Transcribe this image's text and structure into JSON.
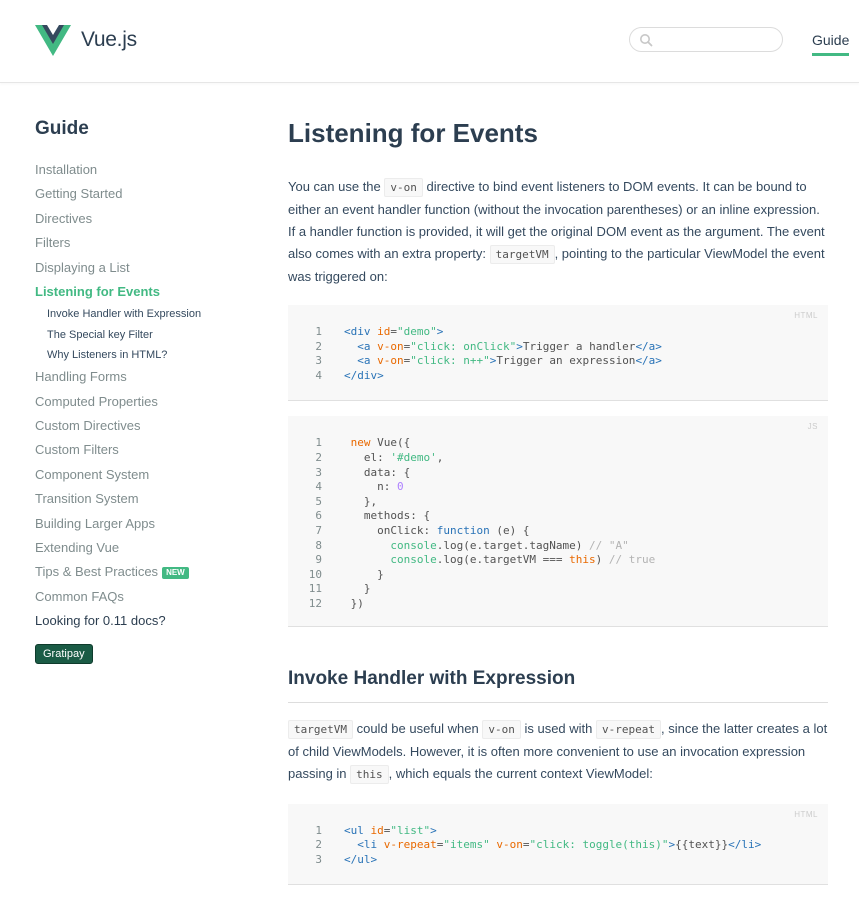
{
  "header": {
    "brand": "Vue.js",
    "search_placeholder": "",
    "nav_guide": "Guide",
    "accent": "#42b983"
  },
  "sidebar": {
    "title": "Guide",
    "items": [
      {
        "label": "Installation"
      },
      {
        "label": "Getting Started"
      },
      {
        "label": "Directives"
      },
      {
        "label": "Filters"
      },
      {
        "label": "Displaying a List"
      },
      {
        "label": "Listening for Events",
        "active": true
      },
      {
        "label": "Invoke Handler with Expression",
        "sub": true
      },
      {
        "label": "The Special key Filter",
        "sub": true
      },
      {
        "label": "Why Listeners in HTML?",
        "sub": true
      },
      {
        "label": "Handling Forms"
      },
      {
        "label": "Computed Properties"
      },
      {
        "label": "Custom Directives"
      },
      {
        "label": "Custom Filters"
      },
      {
        "label": "Component System"
      },
      {
        "label": "Transition System"
      },
      {
        "label": "Building Larger Apps"
      },
      {
        "label": "Extending Vue"
      },
      {
        "label": "Tips & Best Practices",
        "badge": "NEW"
      },
      {
        "label": "Common FAQs"
      },
      {
        "label": "Looking for 0.11 docs?",
        "strong": true
      }
    ],
    "gratipay": "Gratipay"
  },
  "main": {
    "title": "Listening for Events",
    "intro": {
      "t1": "You can use the ",
      "c1": "v-on",
      "t2": " directive to bind event listeners to DOM events. It can be bound to either an event handler function (without the invocation parentheses) or an inline expression. If a handler function is provided, it will get the original DOM event as the argument. The event also comes with an extra property: ",
      "c2": "targetVM",
      "t3": ", pointing to the particular ViewModel the event was triggered on:"
    },
    "code1": {
      "lang": "HTML",
      "lines": [
        [
          {
            "t": "<div ",
            "c": "tag"
          },
          {
            "t": "id",
            "c": "attr"
          },
          {
            "t": "=",
            "c": "plain"
          },
          {
            "t": "\"demo\"",
            "c": "str"
          },
          {
            "t": ">",
            "c": "tag"
          }
        ],
        [
          {
            "t": "  <a ",
            "c": "tag"
          },
          {
            "t": "v-on",
            "c": "attr"
          },
          {
            "t": "=",
            "c": "plain"
          },
          {
            "t": "\"click: onClick\"",
            "c": "str"
          },
          {
            "t": ">",
            "c": "tag"
          },
          {
            "t": "Trigger a handler",
            "c": "plain"
          },
          {
            "t": "</a>",
            "c": "tag"
          }
        ],
        [
          {
            "t": "  <a ",
            "c": "tag"
          },
          {
            "t": "v-on",
            "c": "attr"
          },
          {
            "t": "=",
            "c": "plain"
          },
          {
            "t": "\"click: n++\"",
            "c": "str"
          },
          {
            "t": ">",
            "c": "tag"
          },
          {
            "t": "Trigger an expression",
            "c": "plain"
          },
          {
            "t": "</a>",
            "c": "tag"
          }
        ],
        [
          {
            "t": "</div>",
            "c": "tag"
          }
        ]
      ]
    },
    "code2": {
      "lang": "JS",
      "lines": [
        [
          {
            "t": " new",
            "c": "kw"
          },
          {
            "t": " Vue({",
            "c": "plain"
          }
        ],
        [
          {
            "t": "   el: ",
            "c": "plain"
          },
          {
            "t": "'#demo'",
            "c": "str"
          },
          {
            "t": ",",
            "c": "plain"
          }
        ],
        [
          {
            "t": "   data: {",
            "c": "plain"
          }
        ],
        [
          {
            "t": "     n: ",
            "c": "plain"
          },
          {
            "t": "0",
            "c": "num"
          }
        ],
        [
          {
            "t": "   },",
            "c": "plain"
          }
        ],
        [
          {
            "t": "   methods: {",
            "c": "plain"
          }
        ],
        [
          {
            "t": "     onClick: ",
            "c": "plain"
          },
          {
            "t": "function",
            "c": "fn"
          },
          {
            "t": " (e) {",
            "c": "plain"
          }
        ],
        [
          {
            "t": "       console",
            "c": "str"
          },
          {
            "t": ".log(e.target.tagName) ",
            "c": "plain"
          },
          {
            "t": "// \"A\"",
            "c": "cm"
          }
        ],
        [
          {
            "t": "       console",
            "c": "str"
          },
          {
            "t": ".log(e.targetVM === ",
            "c": "plain"
          },
          {
            "t": "this",
            "c": "kw"
          },
          {
            "t": ") ",
            "c": "plain"
          },
          {
            "t": "// true",
            "c": "cm"
          }
        ],
        [
          {
            "t": "     }",
            "c": "plain"
          }
        ],
        [
          {
            "t": "   }",
            "c": "plain"
          }
        ],
        [
          {
            "t": " })",
            "c": "plain"
          }
        ]
      ]
    },
    "section2": {
      "title": "Invoke Handler with Expression",
      "c1": "targetVM",
      "t1": " could be useful when ",
      "c2": "v-on",
      "t2": " is used with ",
      "c3": "v-repeat",
      "t3": ", since the latter creates a lot of child ViewModels. However, it is often more convenient to use an invocation expression passing in ",
      "c4": "this",
      "t4": ", which equals the current context ViewModel:"
    },
    "code3": {
      "lang": "HTML",
      "lines": [
        [
          {
            "t": "<ul ",
            "c": "tag"
          },
          {
            "t": "id",
            "c": "attr"
          },
          {
            "t": "=",
            "c": "plain"
          },
          {
            "t": "\"list\"",
            "c": "str"
          },
          {
            "t": ">",
            "c": "tag"
          }
        ],
        [
          {
            "t": "  <li ",
            "c": "tag"
          },
          {
            "t": "v-repeat",
            "c": "attr"
          },
          {
            "t": "=",
            "c": "plain"
          },
          {
            "t": "\"items\"",
            "c": "str"
          },
          {
            "t": " ",
            "c": "plain"
          },
          {
            "t": "v-on",
            "c": "attr"
          },
          {
            "t": "=",
            "c": "plain"
          },
          {
            "t": "\"click: toggle(this)\"",
            "c": "str"
          },
          {
            "t": ">",
            "c": "tag"
          },
          {
            "t": "{{text}}",
            "c": "plain"
          },
          {
            "t": "</li>",
            "c": "tag"
          }
        ],
        [
          {
            "t": "</ul>",
            "c": "tag"
          }
        ]
      ]
    }
  }
}
